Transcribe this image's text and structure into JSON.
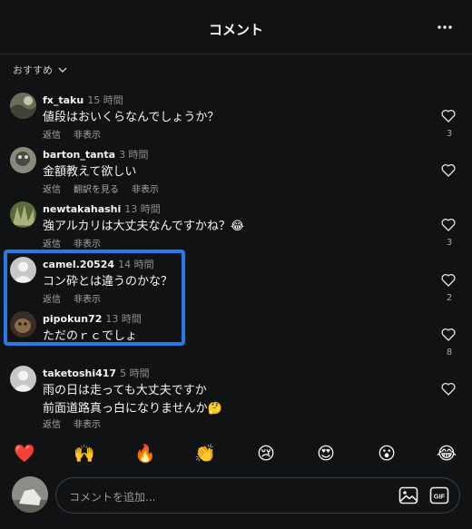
{
  "header": {
    "title": "コメント"
  },
  "sort": {
    "label": "おすすめ"
  },
  "comments": [
    {
      "user": "fx_taku",
      "time": "15 時間",
      "lines": [
        "値段はおいくらなんでしょうか？"
      ],
      "actions": [
        "返信",
        "非表示"
      ],
      "likes": "3"
    },
    {
      "user": "barton_tanta",
      "time": "3 時間",
      "lines": [
        "金額教えて欲しい"
      ],
      "actions": [
        "返信",
        "翻訳を見る",
        "非表示"
      ],
      "likes": ""
    },
    {
      "user": "newtakahashi",
      "time": "13 時間",
      "lines": [
        "強アルカリは大丈夫なんですかね？😂"
      ],
      "actions": [
        "返信",
        "非表示"
      ],
      "likes": "3"
    },
    {
      "user": "camel.20524",
      "time": "14 時間",
      "lines": [
        "コン砕とは違うのかな？"
      ],
      "actions": [
        "返信",
        "非表示"
      ],
      "likes": "2"
    },
    {
      "user": "pipokun72",
      "time": "13 時間",
      "lines": [
        "ただのｒｃでしょ"
      ],
      "actions": [],
      "likes": "8"
    },
    {
      "user": "taketoshi417",
      "time": "5 時間",
      "lines": [
        "雨の日は走っても大丈夫ですか",
        "前面道路真っ白になりませんか🤔"
      ],
      "actions": [
        "返信",
        "非表示"
      ],
      "likes": ""
    }
  ],
  "reactions": [
    "❤️",
    "🙌",
    "🔥",
    "👏",
    "😢",
    "😍",
    "😮",
    "😂"
  ],
  "composer": {
    "placeholder": "コメントを追加..."
  },
  "icons": {
    "more": "more-horizontal-icon",
    "sort": "chevron-down-icon",
    "like": "heart-icon",
    "image": "image-icon",
    "gif": "gif-icon"
  },
  "colors": {
    "background": "#101214",
    "highlight": "#2a78e4"
  }
}
